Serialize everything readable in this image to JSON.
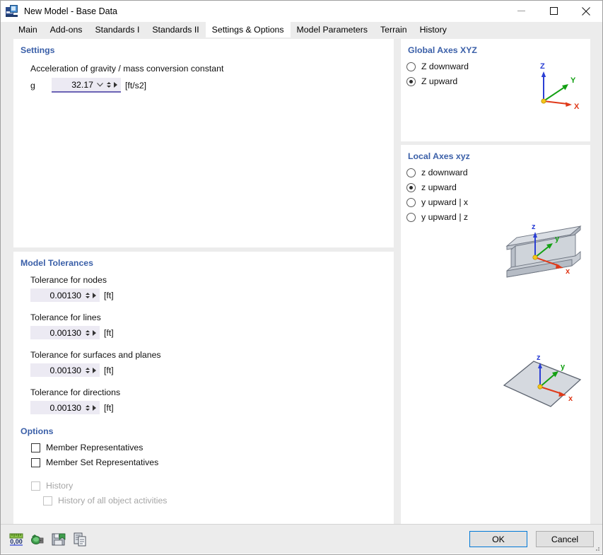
{
  "window": {
    "title": "New Model - Base Data",
    "icon": "app-icon",
    "controls": {
      "minimize": "minimize-icon",
      "maximize": "maximize-icon",
      "close": "close-icon"
    }
  },
  "tabs": [
    {
      "label": "Main",
      "active": false
    },
    {
      "label": "Add-ons",
      "active": false
    },
    {
      "label": "Standards I",
      "active": false
    },
    {
      "label": "Standards II",
      "active": false
    },
    {
      "label": "Settings & Options",
      "active": true
    },
    {
      "label": "Model Parameters",
      "active": false
    },
    {
      "label": "Terrain",
      "active": false
    },
    {
      "label": "History",
      "active": false
    }
  ],
  "settings": {
    "title": "Settings",
    "gravity_caption": "Acceleration of gravity / mass conversion constant",
    "gravity_symbol": "g",
    "gravity_value": "32.17",
    "gravity_unit": "[ft/s2]"
  },
  "tolerances": {
    "title": "Model Tolerances",
    "items": [
      {
        "label": "Tolerance for nodes",
        "value": "0.00130",
        "unit": "[ft]"
      },
      {
        "label": "Tolerance for lines",
        "value": "0.00130",
        "unit": "[ft]"
      },
      {
        "label": "Tolerance for surfaces and planes",
        "value": "0.00130",
        "unit": "[ft]"
      },
      {
        "label": "Tolerance for directions",
        "value": "0.00130",
        "unit": "[ft]"
      }
    ]
  },
  "options": {
    "title": "Options",
    "items": [
      {
        "label": "Member Representatives",
        "checked": false,
        "disabled": false
      },
      {
        "label": "Member Set Representatives",
        "checked": false,
        "disabled": false
      },
      {
        "label": "History",
        "checked": false,
        "disabled": true
      },
      {
        "label": "History of all object activities",
        "checked": false,
        "disabled": true
      }
    ]
  },
  "global_axes": {
    "title": "Global Axes XYZ",
    "options": [
      {
        "label": "Z downward",
        "selected": false
      },
      {
        "label": "Z upward",
        "selected": true
      }
    ],
    "diagram": {
      "axis_z": "Z",
      "axis_y": "Y",
      "axis_x": "X",
      "color_z": "#2b3fd4",
      "color_y": "#13a013",
      "color_x": "#e03a1a",
      "color_origin": "#f5c518"
    }
  },
  "local_axes": {
    "title": "Local Axes xyz",
    "options": [
      {
        "label": "z downward",
        "selected": false
      },
      {
        "label": "z upward",
        "selected": true
      },
      {
        "label": "y upward | x",
        "selected": false
      },
      {
        "label": "y upward | z",
        "selected": false
      }
    ],
    "beam_diagram": {
      "axis_z": "z",
      "axis_y": "y",
      "axis_x": "x",
      "shape": "i-beam"
    },
    "surface_diagram": {
      "axis_z": "z",
      "axis_y": "y",
      "axis_x": "x",
      "shape": "surface-plane"
    }
  },
  "footer": {
    "toolbar": [
      {
        "name": "number-format-icon",
        "label": "0,00"
      },
      {
        "name": "plug-connector-icon",
        "label": ""
      },
      {
        "name": "save-export-icon",
        "label": ""
      },
      {
        "name": "copy-document-icon",
        "label": ""
      }
    ],
    "ok_label": "OK",
    "cancel_label": "Cancel"
  }
}
